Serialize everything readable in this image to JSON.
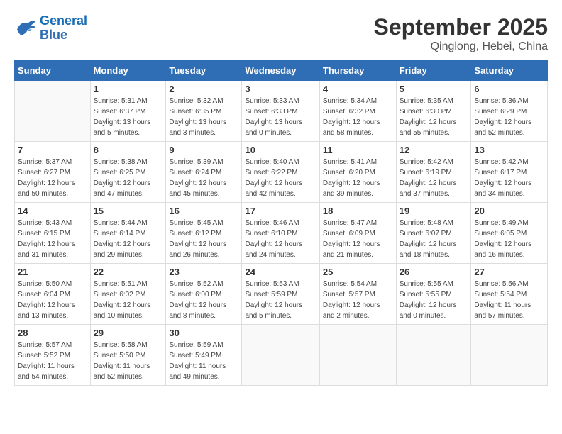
{
  "header": {
    "logo_line1": "General",
    "logo_line2": "Blue",
    "month": "September 2025",
    "location": "Qinglong, Hebei, China"
  },
  "weekdays": [
    "Sunday",
    "Monday",
    "Tuesday",
    "Wednesday",
    "Thursday",
    "Friday",
    "Saturday"
  ],
  "weeks": [
    [
      {
        "day": "",
        "info": ""
      },
      {
        "day": "1",
        "info": "Sunrise: 5:31 AM\nSunset: 6:37 PM\nDaylight: 13 hours\nand 5 minutes."
      },
      {
        "day": "2",
        "info": "Sunrise: 5:32 AM\nSunset: 6:35 PM\nDaylight: 13 hours\nand 3 minutes."
      },
      {
        "day": "3",
        "info": "Sunrise: 5:33 AM\nSunset: 6:33 PM\nDaylight: 13 hours\nand 0 minutes."
      },
      {
        "day": "4",
        "info": "Sunrise: 5:34 AM\nSunset: 6:32 PM\nDaylight: 12 hours\nand 58 minutes."
      },
      {
        "day": "5",
        "info": "Sunrise: 5:35 AM\nSunset: 6:30 PM\nDaylight: 12 hours\nand 55 minutes."
      },
      {
        "day": "6",
        "info": "Sunrise: 5:36 AM\nSunset: 6:29 PM\nDaylight: 12 hours\nand 52 minutes."
      }
    ],
    [
      {
        "day": "7",
        "info": "Sunrise: 5:37 AM\nSunset: 6:27 PM\nDaylight: 12 hours\nand 50 minutes."
      },
      {
        "day": "8",
        "info": "Sunrise: 5:38 AM\nSunset: 6:25 PM\nDaylight: 12 hours\nand 47 minutes."
      },
      {
        "day": "9",
        "info": "Sunrise: 5:39 AM\nSunset: 6:24 PM\nDaylight: 12 hours\nand 45 minutes."
      },
      {
        "day": "10",
        "info": "Sunrise: 5:40 AM\nSunset: 6:22 PM\nDaylight: 12 hours\nand 42 minutes."
      },
      {
        "day": "11",
        "info": "Sunrise: 5:41 AM\nSunset: 6:20 PM\nDaylight: 12 hours\nand 39 minutes."
      },
      {
        "day": "12",
        "info": "Sunrise: 5:42 AM\nSunset: 6:19 PM\nDaylight: 12 hours\nand 37 minutes."
      },
      {
        "day": "13",
        "info": "Sunrise: 5:42 AM\nSunset: 6:17 PM\nDaylight: 12 hours\nand 34 minutes."
      }
    ],
    [
      {
        "day": "14",
        "info": "Sunrise: 5:43 AM\nSunset: 6:15 PM\nDaylight: 12 hours\nand 31 minutes."
      },
      {
        "day": "15",
        "info": "Sunrise: 5:44 AM\nSunset: 6:14 PM\nDaylight: 12 hours\nand 29 minutes."
      },
      {
        "day": "16",
        "info": "Sunrise: 5:45 AM\nSunset: 6:12 PM\nDaylight: 12 hours\nand 26 minutes."
      },
      {
        "day": "17",
        "info": "Sunrise: 5:46 AM\nSunset: 6:10 PM\nDaylight: 12 hours\nand 24 minutes."
      },
      {
        "day": "18",
        "info": "Sunrise: 5:47 AM\nSunset: 6:09 PM\nDaylight: 12 hours\nand 21 minutes."
      },
      {
        "day": "19",
        "info": "Sunrise: 5:48 AM\nSunset: 6:07 PM\nDaylight: 12 hours\nand 18 minutes."
      },
      {
        "day": "20",
        "info": "Sunrise: 5:49 AM\nSunset: 6:05 PM\nDaylight: 12 hours\nand 16 minutes."
      }
    ],
    [
      {
        "day": "21",
        "info": "Sunrise: 5:50 AM\nSunset: 6:04 PM\nDaylight: 12 hours\nand 13 minutes."
      },
      {
        "day": "22",
        "info": "Sunrise: 5:51 AM\nSunset: 6:02 PM\nDaylight: 12 hours\nand 10 minutes."
      },
      {
        "day": "23",
        "info": "Sunrise: 5:52 AM\nSunset: 6:00 PM\nDaylight: 12 hours\nand 8 minutes."
      },
      {
        "day": "24",
        "info": "Sunrise: 5:53 AM\nSunset: 5:59 PM\nDaylight: 12 hours\nand 5 minutes."
      },
      {
        "day": "25",
        "info": "Sunrise: 5:54 AM\nSunset: 5:57 PM\nDaylight: 12 hours\nand 2 minutes."
      },
      {
        "day": "26",
        "info": "Sunrise: 5:55 AM\nSunset: 5:55 PM\nDaylight: 12 hours\nand 0 minutes."
      },
      {
        "day": "27",
        "info": "Sunrise: 5:56 AM\nSunset: 5:54 PM\nDaylight: 11 hours\nand 57 minutes."
      }
    ],
    [
      {
        "day": "28",
        "info": "Sunrise: 5:57 AM\nSunset: 5:52 PM\nDaylight: 11 hours\nand 54 minutes."
      },
      {
        "day": "29",
        "info": "Sunrise: 5:58 AM\nSunset: 5:50 PM\nDaylight: 11 hours\nand 52 minutes."
      },
      {
        "day": "30",
        "info": "Sunrise: 5:59 AM\nSunset: 5:49 PM\nDaylight: 11 hours\nand 49 minutes."
      },
      {
        "day": "",
        "info": ""
      },
      {
        "day": "",
        "info": ""
      },
      {
        "day": "",
        "info": ""
      },
      {
        "day": "",
        "info": ""
      }
    ]
  ]
}
